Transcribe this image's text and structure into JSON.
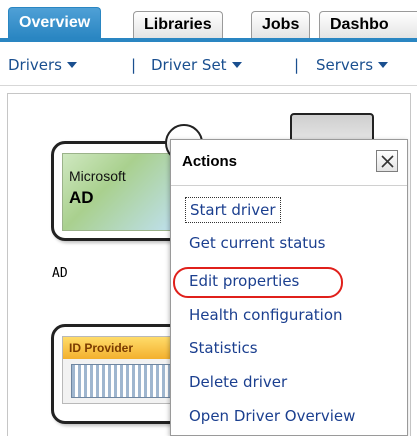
{
  "tabs": [
    {
      "label": "Overview",
      "active": true
    },
    {
      "label": "Libraries",
      "active": false
    },
    {
      "label": "Jobs",
      "active": false
    },
    {
      "label": "Dashbo",
      "active": false
    }
  ],
  "menubar": {
    "drivers": "Drivers",
    "driver_set": "Driver Set",
    "servers": "Servers",
    "separator": "|"
  },
  "drivers": {
    "ad": {
      "logo_line1": "Microsoft",
      "logo_line2": "AD",
      "caption": "AD"
    },
    "idp": {
      "logo_text": "ID Provider"
    }
  },
  "actions_popup": {
    "title": "Actions",
    "items": [
      "Start driver",
      "Get current status",
      "Edit properties",
      "Health configuration",
      "Statistics",
      "Delete driver",
      "Open Driver Overview"
    ],
    "highlighted": "Edit properties",
    "highlight_color": "#e0201b"
  },
  "colors": {
    "accent": "#2a86c2",
    "link": "#1b3f8f"
  }
}
